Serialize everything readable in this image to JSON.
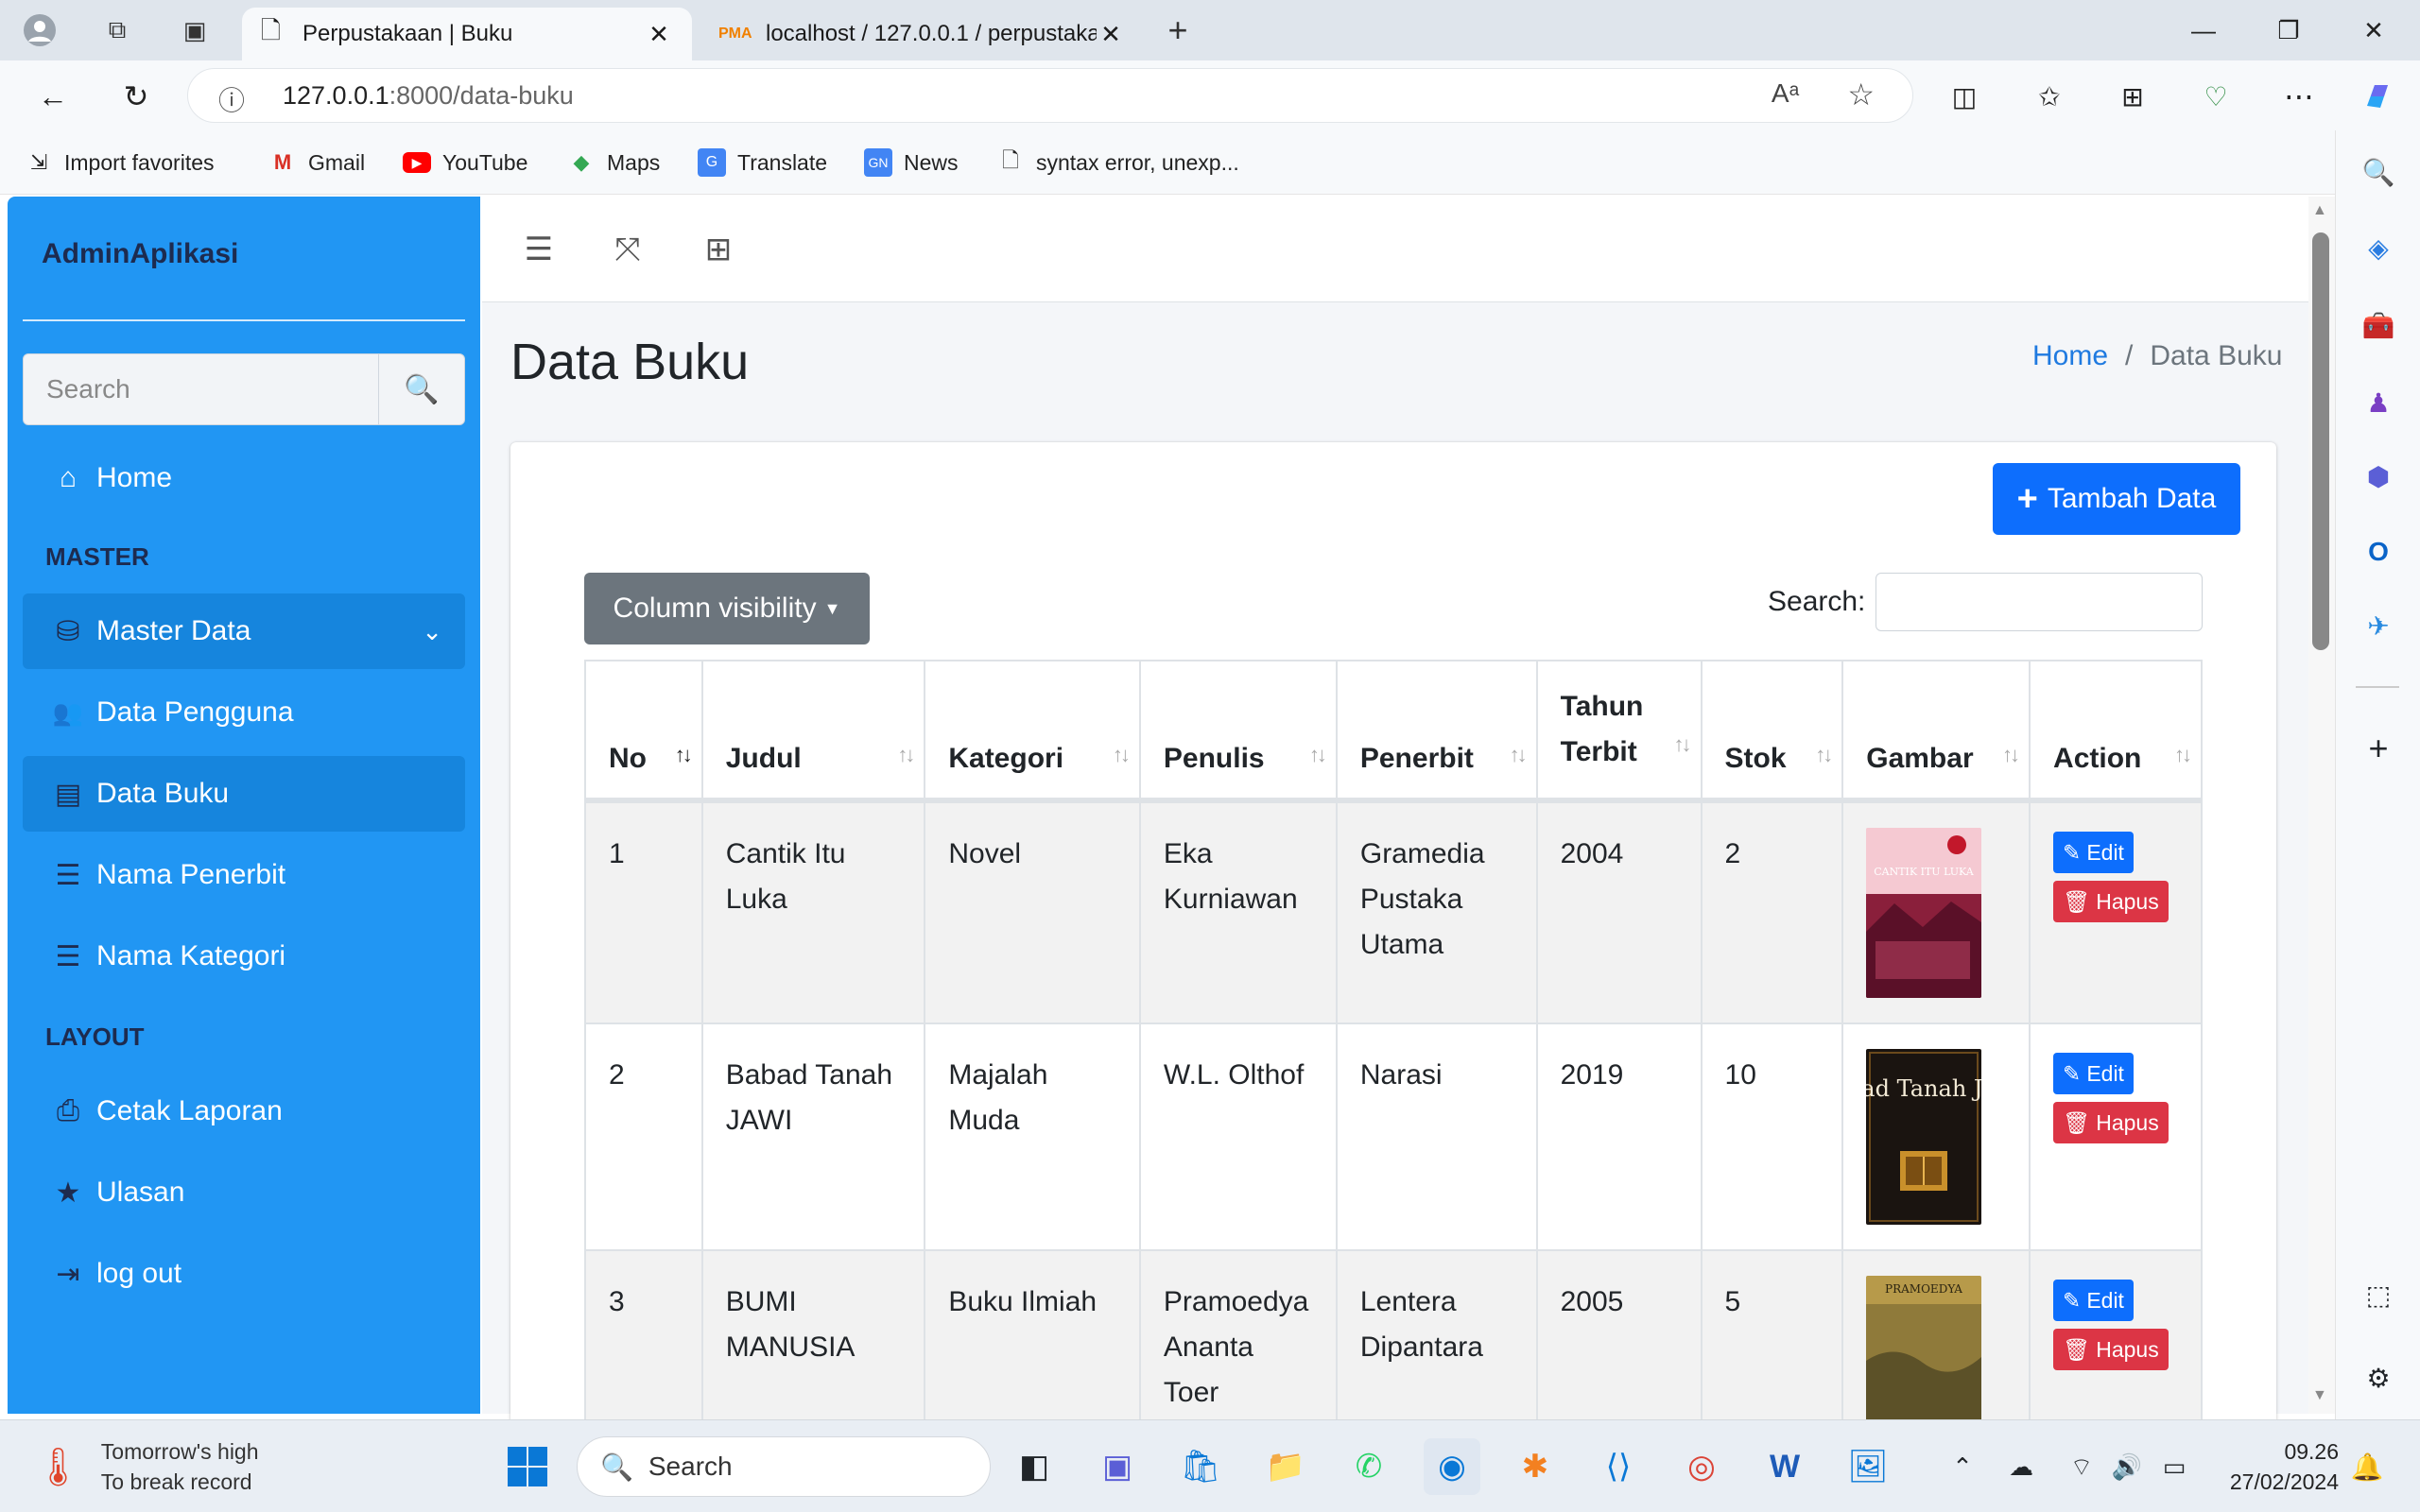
{
  "browser": {
    "tabs": [
      {
        "label": "Perpustakaan | Buku",
        "active": true
      },
      {
        "label": "localhost / 127.0.0.1 / perpustaka",
        "active": false
      }
    ],
    "url": {
      "host": "127.0.0.1",
      "rest": ":8000/data-buku"
    },
    "bookmarks": [
      {
        "label": "Import favorites",
        "icon": "import-icon"
      },
      {
        "label": "Gmail",
        "icon": "gmail-icon"
      },
      {
        "label": "YouTube",
        "icon": "youtube-icon"
      },
      {
        "label": "Maps",
        "icon": "maps-icon"
      },
      {
        "label": "Translate",
        "icon": "translate-icon"
      },
      {
        "label": "News",
        "icon": "news-icon"
      },
      {
        "label": "syntax error, unexp...",
        "icon": "page-icon"
      }
    ]
  },
  "sidebar": {
    "brand": "AdminAplikasi",
    "search_placeholder": "Search",
    "home": "Home",
    "section_master": "MASTER",
    "master_data": "Master Data",
    "items": [
      {
        "label": "Data Pengguna"
      },
      {
        "label": "Data Buku"
      },
      {
        "label": "Nama Penerbit"
      },
      {
        "label": "Nama Kategori"
      }
    ],
    "section_layout": "LAYOUT",
    "layout_items": [
      {
        "label": "Cetak Laporan"
      },
      {
        "label": "Ulasan"
      },
      {
        "label": "log out"
      }
    ]
  },
  "page": {
    "title": "Data Buku",
    "breadcrumb": {
      "home": "Home",
      "sep": "/",
      "current": "Data Buku"
    },
    "add_button": "Tambah Data",
    "column_visibility": "Column visibility",
    "search_label": "Search:"
  },
  "table": {
    "headers": [
      "No",
      "Judul",
      "Kategori",
      "Penulis",
      "Penerbit",
      "Tahun Terbit",
      "Stok",
      "Gambar",
      "Action"
    ],
    "edit_label": "Edit",
    "delete_label": "Hapus",
    "rows": [
      {
        "no": "1",
        "judul": "Cantik Itu Luka",
        "kategori": "Novel",
        "penulis": "Eka Kurniawan",
        "penerbit": "Gramedia Pustaka Utama",
        "tahun": "2004",
        "stok": "2",
        "cover_text": "CANTIK ITU LUKA"
      },
      {
        "no": "2",
        "judul": "Babad Tanah JAWI",
        "kategori": "Majalah Muda",
        "penulis": "W.L. Olthof",
        "penerbit": "Narasi",
        "tahun": "2019",
        "stok": "10",
        "cover_text": "Babad Tanah JAWI"
      },
      {
        "no": "3",
        "judul": "BUMI MANUSIA",
        "kategori": "Buku Ilmiah",
        "penulis": "Pramoedya Ananta Toer",
        "penerbit": "Lentera Dipantara",
        "tahun": "2005",
        "stok": "5",
        "cover_text": "PRAMOEDYA"
      }
    ]
  },
  "taskbar": {
    "weather_line1": "Tomorrow's high",
    "weather_line2": "To break record",
    "search": "Search",
    "time": "09.26",
    "date": "27/02/2024"
  },
  "colors": {
    "sidebar": "#2196f3",
    "primary": "#0d6efd",
    "danger": "#dc3545",
    "secondary": "#6c757d"
  }
}
